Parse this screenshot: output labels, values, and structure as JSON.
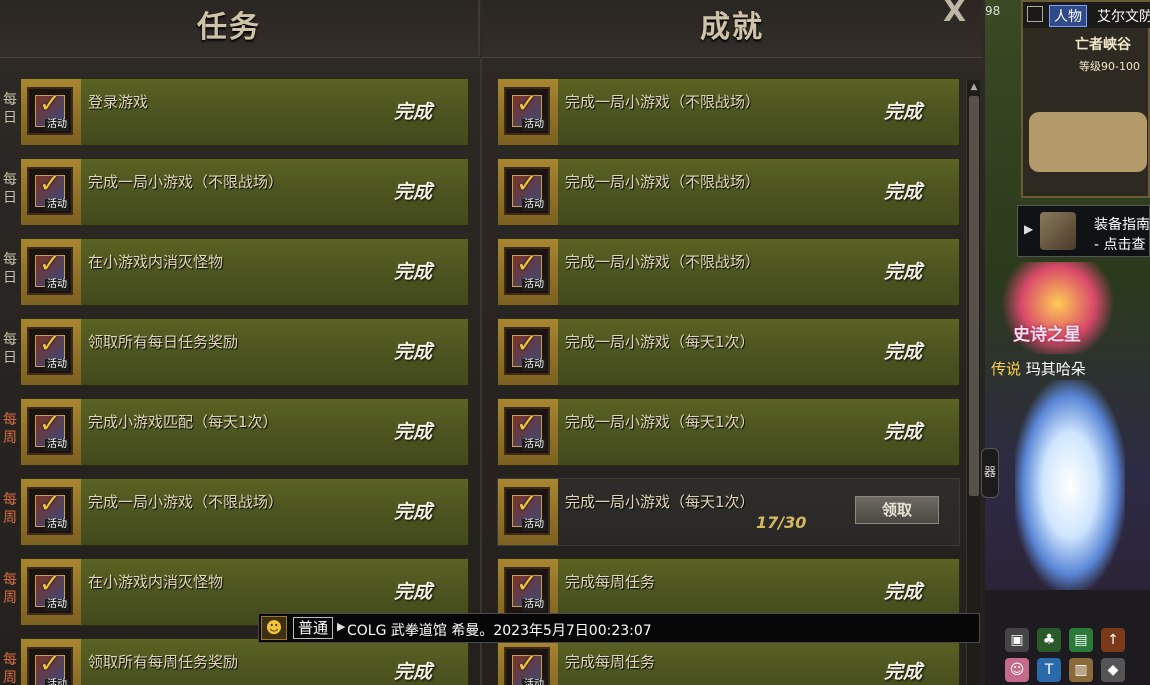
{
  "header": {
    "left_title": "任务",
    "right_title": "成就",
    "close_label": "X"
  },
  "colors": {
    "row_green": "#4c5420",
    "row_dark": "#2c2a27",
    "weekly_label": "#d96b40",
    "progress": "#d6b862"
  },
  "tasks": [
    {
      "freq": "每日",
      "freq_type": "daily",
      "text": "登录游戏",
      "status": "完成",
      "icon": "task-complete-icon"
    },
    {
      "freq": "每日",
      "freq_type": "daily",
      "text": "完成一局小游戏（不限战场）",
      "status": "完成",
      "icon": "task-complete-icon"
    },
    {
      "freq": "每日",
      "freq_type": "daily",
      "text": "在小游戏内消灭怪物",
      "status": "完成",
      "icon": "task-complete-icon"
    },
    {
      "freq": "每日",
      "freq_type": "daily",
      "text": "领取所有每日任务奖励",
      "status": "完成",
      "icon": "task-complete-icon"
    },
    {
      "freq": "每周",
      "freq_type": "weekly",
      "text": "完成小游戏匹配（每天1次）",
      "status": "完成",
      "icon": "task-complete-icon"
    },
    {
      "freq": "每周",
      "freq_type": "weekly",
      "text": "完成一局小游戏（不限战场）",
      "status": "完成",
      "icon": "task-complete-icon"
    },
    {
      "freq": "每周",
      "freq_type": "weekly",
      "text": "在小游戏内消灭怪物",
      "status": "完成",
      "icon": "task-complete-icon"
    },
    {
      "freq": "每周",
      "freq_type": "weekly",
      "text": "领取所有每周任务奖励",
      "status": "完成",
      "icon": "task-complete-icon"
    }
  ],
  "achievements": [
    {
      "text": "完成一局小游戏（不限战场）",
      "status": "完成",
      "icon": "achievement-icon"
    },
    {
      "text": "完成一局小游戏（不限战场）",
      "status": "完成",
      "icon": "achievement-icon"
    },
    {
      "text": "完成一局小游戏（不限战场）",
      "status": "完成",
      "icon": "achievement-icon"
    },
    {
      "text": "完成一局小游戏（每天1次）",
      "status": "完成",
      "icon": "achievement-icon"
    },
    {
      "text": "完成一局小游戏（每天1次）",
      "status": "完成",
      "icon": "achievement-icon"
    },
    {
      "text": "完成一局小游戏（每天1次）",
      "progress": "17/30",
      "button": "领取",
      "icon": "achievement-icon"
    },
    {
      "text": "完成每周任务",
      "status": "完成",
      "icon": "achievement-icon"
    },
    {
      "text": "完成每周任务",
      "status": "完成",
      "icon": "achievement-icon"
    }
  ],
  "icon_tag": "活动",
  "game": {
    "level_number": "98",
    "minimap_tab": "人物",
    "zone": "艾尔文防",
    "area": "亡者峡谷",
    "area_level": "等级90-100",
    "guide_line1": "装备指南",
    "guide_line2": "- 点击查",
    "emblem_text": "史诗之星",
    "char_rank": "传说",
    "char_name": "玛其哈朵",
    "side_tab": "器"
  },
  "chat": {
    "channel": "普通",
    "message": "COLG 武拳道馆 希曼。2023年5月7日00:23:07"
  }
}
